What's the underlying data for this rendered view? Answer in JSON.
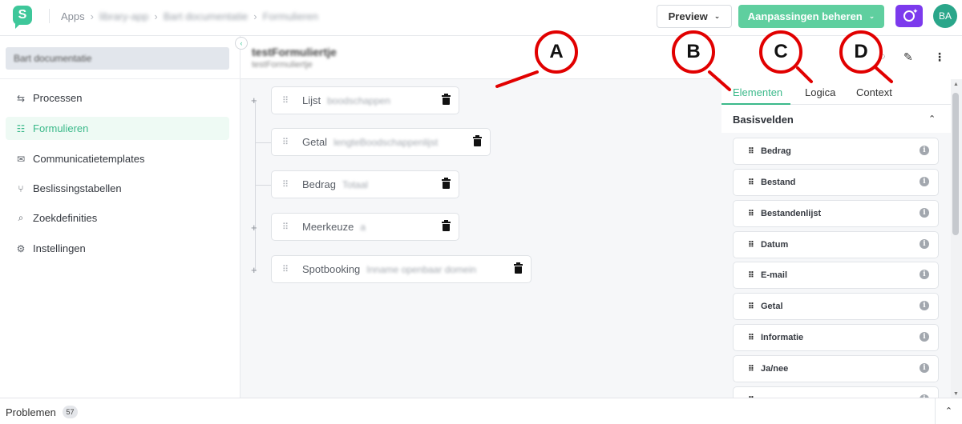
{
  "topbar": {
    "logo_letter": "S",
    "breadcrumb": [
      "Apps",
      "library-app",
      "Bart documentatie",
      "Formulieren"
    ],
    "preview_label": "Preview",
    "manage_label": "Aanpassingen beheren",
    "avatar_initials": "BA",
    "accent_color": "#5fcf9f",
    "ai_color": "#7c3aed"
  },
  "sidebar": {
    "project": "Bart documentatie",
    "items": [
      {
        "label": "Processen",
        "icon": "process-icon"
      },
      {
        "label": "Formulieren",
        "icon": "form-icon",
        "active": true
      },
      {
        "label": "Communicatietemplates",
        "icon": "mail-icon"
      },
      {
        "label": "Beslissingstabellen",
        "icon": "decision-icon"
      },
      {
        "label": "Zoekdefinities",
        "icon": "search-icon"
      },
      {
        "label": "Instellingen",
        "icon": "gear-icon"
      }
    ]
  },
  "form": {
    "title": "testFormuliertje",
    "subtitle": "testFormuliertje",
    "fields": [
      {
        "type": "Lijst",
        "key": "boodschappen"
      },
      {
        "type": "Getal",
        "key": "lengteBoodschappenlijst"
      },
      {
        "type": "Bedrag",
        "key": "Totaal"
      },
      {
        "type": "Meerkeuze",
        "key": "a"
      },
      {
        "type": "Spotbooking",
        "key": "Inname openbaar domein"
      }
    ]
  },
  "panel": {
    "tabs": [
      "Elementen",
      "Logica",
      "Context"
    ],
    "active_tab": "Elementen",
    "section_title": "Basisvelden",
    "elements": [
      "Bedrag",
      "Bestand",
      "Bestandenlijst",
      "Datum",
      "E-mail",
      "Getal",
      "Informatie",
      "Ja/nee"
    ]
  },
  "bottombar": {
    "problems_label": "Problemen",
    "problems_count": "57"
  },
  "annotations": {
    "markers": [
      "A",
      "B",
      "C",
      "D"
    ],
    "color": "#e10000"
  }
}
